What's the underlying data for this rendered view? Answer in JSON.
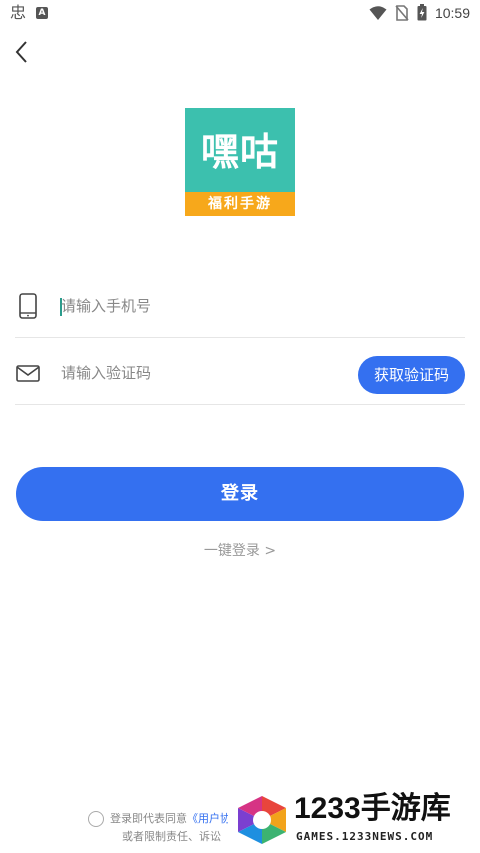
{
  "status_bar": {
    "app_icon_1": "忠",
    "app_icon_2": "A",
    "time": "10:59",
    "icons": [
      "wifi-icon",
      "no-sim-icon",
      "battery-charging-icon"
    ]
  },
  "nav": {
    "back_icon": "chevron-left-icon"
  },
  "logo": {
    "big_text": "嘿咕",
    "small_text": "福利手游",
    "bg_color": "#3cc0ae",
    "band_color": "#f7a81b"
  },
  "form": {
    "phone": {
      "icon": "phone-icon",
      "placeholder": "请输入手机号",
      "value": ""
    },
    "code": {
      "icon": "mail-icon",
      "placeholder": "请输入验证码",
      "value": "",
      "get_code_label": "获取验证码"
    }
  },
  "login_label": "登录",
  "one_key_login": "一键登录 >",
  "agreement": {
    "line1_prefix": "登录即代表同意",
    "line1_link": "《用户协",
    "line2": "或者限制责任、诉讼"
  },
  "watermark": {
    "title": "1233手游库",
    "subtitle": "GAMES.1233NEWS.COM"
  },
  "colors": {
    "accent": "#3470f0",
    "placeholder": "#888888",
    "divider": "#e6e6e6"
  }
}
